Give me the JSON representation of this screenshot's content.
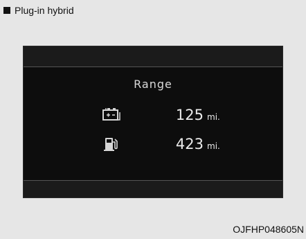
{
  "caption": {
    "text": "Plug-in hybrid"
  },
  "display": {
    "title": "Range",
    "rows": [
      {
        "icon": "battery-icon",
        "value": "125",
        "unit": "mi."
      },
      {
        "icon": "fuel-pump-icon",
        "value": "423",
        "unit": "mi."
      }
    ]
  },
  "image_code": "OJFHP048605N",
  "colors": {
    "background": "#e6e6e6",
    "screen": "#0d0d0d",
    "text_on_screen": "#eaeaea"
  }
}
